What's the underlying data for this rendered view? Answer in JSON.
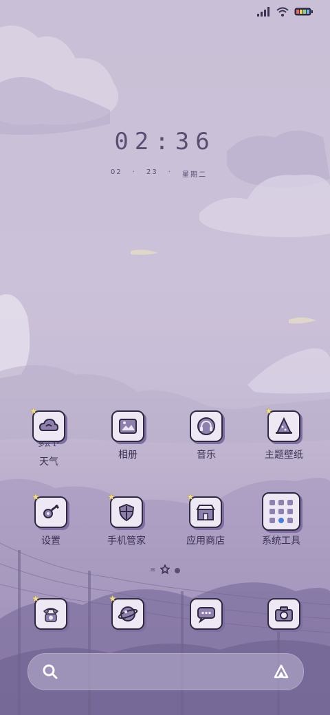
{
  "status_bar": {
    "signal_icon": "signal-icon",
    "wifi_icon": "wifi-icon",
    "battery_icon": "battery-icon"
  },
  "lock": {
    "time": "02:36",
    "date_month": "02",
    "date_sep": "·",
    "date_day": "23",
    "weekday": "星期二"
  },
  "apps_row1": [
    {
      "label": "天气",
      "sub": "多云 1°",
      "icon": "weather-icon"
    },
    {
      "label": "相册",
      "icon": "gallery-icon"
    },
    {
      "label": "音乐",
      "icon": "music-icon"
    },
    {
      "label": "主题壁纸",
      "icon": "theme-icon"
    }
  ],
  "apps_row2": [
    {
      "label": "设置",
      "icon": "settings-icon"
    },
    {
      "label": "手机管家",
      "icon": "security-icon"
    },
    {
      "label": "应用商店",
      "icon": "app-store-icon"
    },
    {
      "label": "系统工具",
      "icon": "folder-icon"
    }
  ],
  "dock": [
    {
      "icon": "phone-icon"
    },
    {
      "icon": "browser-icon"
    },
    {
      "icon": "messages-icon"
    },
    {
      "icon": "camera-icon"
    }
  ],
  "pager": {
    "lines": "≡",
    "home": "✩"
  },
  "search": {
    "search_icon": "search-icon",
    "assistant_icon": "assistant-icon"
  },
  "colors": {
    "primary": "#5a4f73",
    "tile_bg": "#ede8f3",
    "outline": "#2e2840",
    "shadow": "#7e6fa0"
  }
}
